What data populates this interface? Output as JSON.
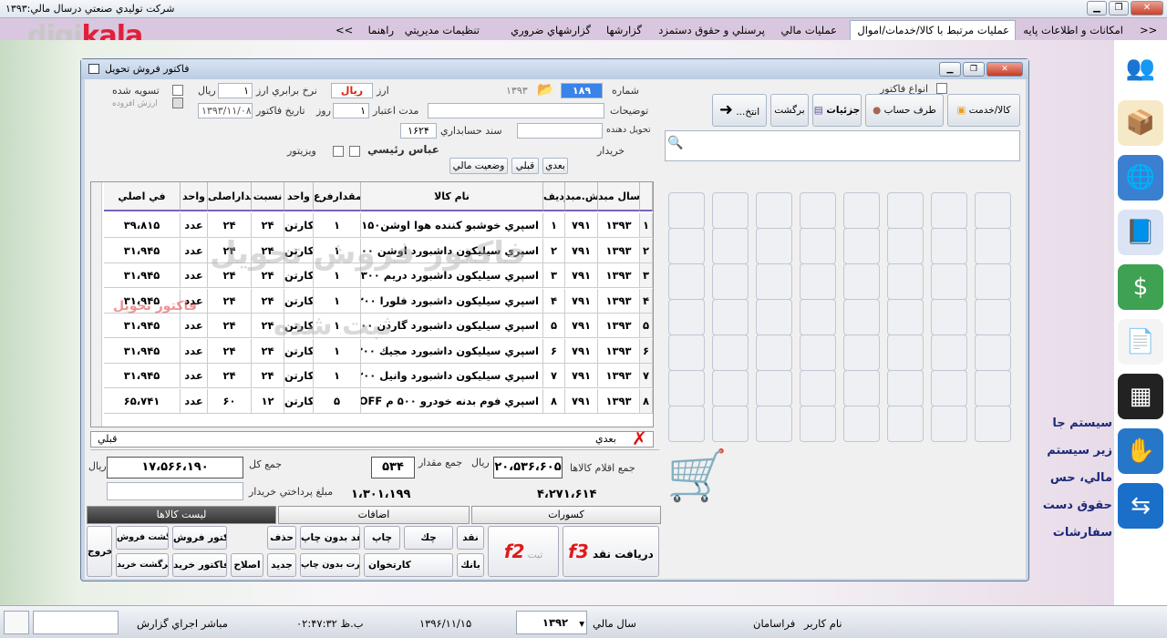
{
  "window": {
    "title": "شركت توليدي صنعتي درسال مالي:۱۳۹۳"
  },
  "menu": {
    "items": [
      "امكانات و اطلاعات پايه",
      "عمليات مرتبط با كالا/خدمات/اموال",
      "عمليات مالي",
      "پرسنلي و حقوق دستمزد",
      "گزارشها",
      "گزارشهاي ضروري",
      "تنظيمات مديريتي",
      "راهنما"
    ],
    "scroll_left": "<<",
    "scroll_right": ">>",
    "active_index": 1
  },
  "logo": {
    "part1": "digi",
    "part2": "kala"
  },
  "dialog": {
    "title": "فاكتور فروش تحويل",
    "labels": {
      "number": "شماره",
      "currency": "ارز",
      "rate": "نرخ برابري ارز",
      "settled": "تسويه شده",
      "value_added": "ارزش افزوده",
      "desc": "توضيحات",
      "validity": "مدت اعتبار",
      "day": "روز",
      "invoice_date": "تاريخ فاكتور",
      "delivery": "تحويل دهنده",
      "doc": "سند حسابداري",
      "buyer": "خريدار",
      "visitor": "ويزيتور",
      "invoice_types": "انواع فاكتور"
    },
    "values": {
      "year": "۱۳۹۳",
      "number": "۱۸۹",
      "currency": "ريال",
      "rate": "۱",
      "rate_unit": "ريال",
      "validity": "۱",
      "date": "۱۳۹۳/۱۱/۰۸",
      "doc": "۱۶۲۴",
      "buyer": "عباس رئيسي"
    },
    "toolbar": {
      "goods": "كالا/خدمت",
      "account": "طرف حساب",
      "details": "جزئيات",
      "return": "برگشت",
      "esc": "...انتخ"
    },
    "small_buttons": {
      "next": "بعدي",
      "prev": "قبلي",
      "status": "وضعيت مالي"
    },
    "columns": [
      "",
      "سال مبد",
      "ش.مبد",
      "رديف",
      "نام كالا",
      "مقدارفرع",
      "واحد",
      "نسبت",
      "مقداراصلی",
      "واحد",
      "في اصلي"
    ],
    "rows": [
      [
        "۱",
        "۱۳۹۳",
        "۷۹۱",
        "۱",
        "اسپري خوشبو كننده هوا اوشن۱۵۰م",
        "۱",
        "كارتن",
        "۲۴",
        "۲۴",
        "عدد",
        "۳۹،۸۱۵"
      ],
      [
        "۲",
        "۱۳۹۳",
        "۷۹۱",
        "۲",
        "اسپري سيليكون داشبورد اوشن ۳۰۰",
        "۱",
        "كارتن",
        "۲۴",
        "۲۴",
        "عدد",
        "۳۱،۹۴۵"
      ],
      [
        "۳",
        "۱۳۹۳",
        "۷۹۱",
        "۳",
        "اسپري سيليكون داشبورد دريم ۳۰۰",
        "۱",
        "كارتن",
        "۲۴",
        "۲۴",
        "عدد",
        "۳۱،۹۴۵"
      ],
      [
        "۴",
        "۱۳۹۳",
        "۷۹۱",
        "۴",
        "اسپري سيليكون داشبورد فلورا ۳۰۰",
        "۱",
        "كارتن",
        "۲۴",
        "۲۴",
        "عدد",
        "۳۱،۹۴۵"
      ],
      [
        "۵",
        "۱۳۹۳",
        "۷۹۱",
        "۵",
        "اسپري سيليكون داشبورد گاردن ۳۰۰",
        "۱",
        "كارتن",
        "۲۴",
        "۲۴",
        "عدد",
        "۳۱،۹۴۵"
      ],
      [
        "۶",
        "۱۳۹۳",
        "۷۹۱",
        "۶",
        "اسپري سيليكون داشبورد مجيك ۳۰۰",
        "۱",
        "كارتن",
        "۲۴",
        "۲۴",
        "عدد",
        "۳۱،۹۴۵"
      ],
      [
        "۷",
        "۱۳۹۳",
        "۷۹۱",
        "۷",
        "اسپري سيليكون داشبورد وانيل ۳۰۰",
        "۱",
        "كارتن",
        "۲۴",
        "۲۴",
        "عدد",
        "۳۱،۹۴۵"
      ],
      [
        "۸",
        "۱۳۹۳",
        "۷۹۱",
        "۸",
        "اسپري فوم بدنه خودرو ۵۰۰ م OFF",
        "۵",
        "كارتن",
        "۱۲",
        "۶۰",
        "عدد",
        "۶۵،۷۴۱"
      ]
    ],
    "watermark": {
      "line1": "فاكتور فروش تحويل",
      "line2": "ثبت شده",
      "line3": "فاكتور تحويل"
    },
    "nav": {
      "next": "بعدي",
      "prev": "قبلي"
    },
    "totals": {
      "items_label": "جمع اقلام كالاها",
      "items_value": "۲۰،۵۳۶،۶۰۵",
      "rial": "ريال",
      "qty_label": "جمع مقدار",
      "qty_value": "۵۳۴",
      "total_label": "جمع كل",
      "total_value": "۱۷،۵۶۶،۱۹۰",
      "paid_label": "مبلغ پرداختي خريدار",
      "paid_value": "۱،۳۰۱،۱۹۹",
      "discount_value": "۴،۲۷۱،۶۱۴"
    },
    "tabs": [
      "ليست كالاها",
      "اضافات",
      "كسورات"
    ],
    "actions": {
      "receive": "دريافت نقد",
      "f3": "f3",
      "sabt": "ثبت",
      "f2": "f2",
      "cash": "نقد",
      "bank": "بانك",
      "cheque": "چك",
      "card": "كارتخوان",
      "print": "چاپ",
      "noprint_cash": "نقد بدون چاپ",
      "noprint_card": "كارت بدون چاپ",
      "delete": "حذف",
      "new": "جديد",
      "edit": "اصلاح",
      "sales_inv": "فاكتور فروش",
      "buy_inv": "فاكتور خريد",
      "sales_ret": "برگشت فروش",
      "buy_ret": "برگشت خريد",
      "exit": "خروج"
    }
  },
  "background_text": [
    "سيستم جا",
    "زير سيستم",
    "مالي، حس",
    "حقوق دست",
    "سفارشات"
  ],
  "status": {
    "user_label": "نام كاربر",
    "user": "فراسامان",
    "year_label": "سال مالي",
    "year": "۱۳۹۲",
    "date": "۱۳۹۶/۱۱/۱۵",
    "time": "۰۲:۴۷:۳۲ ب.ظ",
    "report": "مباشر اجراي گزارش"
  }
}
